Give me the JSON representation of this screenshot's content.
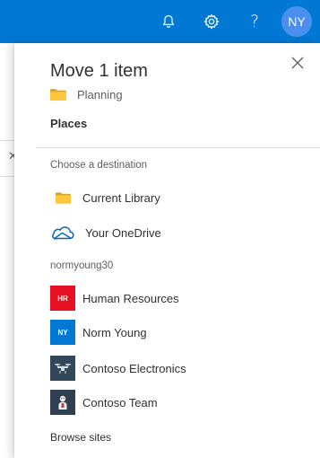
{
  "suitebar": {
    "accent": "#0078d4",
    "icons": [
      "bell-icon",
      "gear-icon",
      "help-icon"
    ],
    "help_glyph": "?",
    "avatar_initials": "NY"
  },
  "panel": {
    "title": "Move 1 item",
    "current_folder": "Planning",
    "places_heading": "Places",
    "choose_label": "Choose a destination",
    "destinations": [
      {
        "label": "Current Library",
        "icon": "folder-icon"
      },
      {
        "label": "Your OneDrive",
        "icon": "onedrive-cloud-icon"
      }
    ],
    "account_name": "normyoung30",
    "sites": [
      {
        "label": "Human Resources",
        "tile_text": "HR",
        "color": "#e81123"
      },
      {
        "label": "Norm Young",
        "tile_text": "NY",
        "color": "#0078d4"
      },
      {
        "label": "Contoso Electronics",
        "tile_icon": "drone-icon",
        "color": "#33475b"
      },
      {
        "label": "Contoso Team",
        "tile_icon": "team-logo-icon",
        "color": "#2f3f4f"
      }
    ],
    "browse_label": "Browse sites"
  }
}
